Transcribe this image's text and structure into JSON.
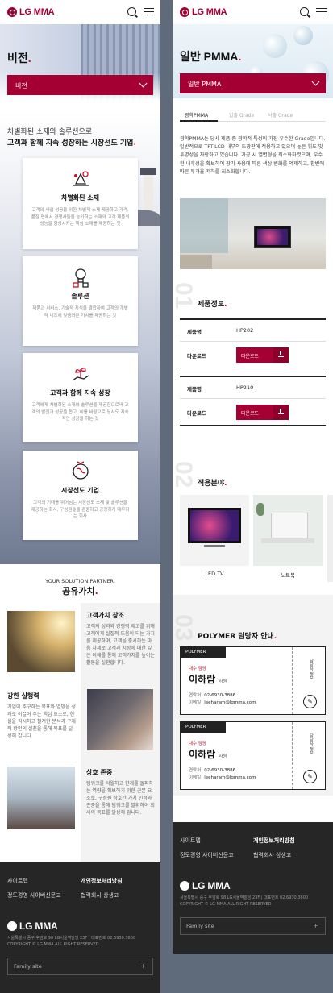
{
  "left": {
    "logo": "LG MMA",
    "page_title": "비전",
    "select_label": "비전",
    "intro_line1": "차별화된 소재와 솔루션으로",
    "intro_line2": "고객과 함께 지속 성장하는 시장선도 기업",
    "cards": [
      {
        "title": "차별화된 소재",
        "desc": "고객의 사업 성공을 위한 차별적 소재 제공하고 가격, 품질 면에서 경쟁사들을 능가하는 소재와 고객 제품의 성능을 향상시키는 핵심 소재를 제공하는 것"
      },
      {
        "title": "솔루션",
        "desc": "제품과 서비스, 기술적 지식을 결합하여 고객의 개별적 니즈에 맞춤화된 가치를 제공하는 것"
      },
      {
        "title": "고객과 함께 지속 성장",
        "desc": "고객에게 차별화된 소재와 솔루션을 제공함으로써 고객의 발전과 성공을 돕고, 이를 바탕으로 당사도 지속적인 성장을 하는 것"
      },
      {
        "title": "시장선도 기업",
        "desc": "고객의 기대를 뛰어넘는 시장선도 소재 및 솔루션을 제공하는 회사, 구성원들을 존중하고 공정하게 대우하는 회사"
      }
    ],
    "values_kicker": "YOUR SOLUTION PARTNER,",
    "values_title": "공유가치",
    "values": [
      {
        "title": "고객가치 창조",
        "desc": "고객의 성과와 경쟁력 제고를 위해 고객에게 실질적 도움이 되는 가치를 제공하며, 고객을 중시하는 마음 자세로 고객과 시장에 대한 깊은 이해를 통해 고객가치를 높이는 활동을 실천합니다."
      },
      {
        "title": "강한 실행력",
        "desc": "기업이 추구하는 목표와 열망을 성과로 이끌어 주는 핵심 요소로, 현실을 직시하고 철저한 분석과 구체적 방안의 실천을 통해 목표를 달성해 갑니다."
      },
      {
        "title": "상호 존중",
        "desc": "팀워크를 탁월하고 한계를 돌파하는 역량을 확보하기 위한 근본 요소로, 구성원 상호간 가치 인정과 존중을 통해 팀워크를 발휘하여 회사의 목표를 달성해 갑니다."
      }
    ],
    "footer": {
      "links": [
        "사이트맵",
        "개인정보처리방침",
        "정도경영 사이버신문고",
        "협력회사 상생고"
      ],
      "logo": "LG MMA",
      "address": "서울특별시 중구 후암로 98 LG서울역빌딩 23F | 대표번호 02.6930.3800",
      "copyright": "COPYRIGHT © LG MMA ALL RIGHT RESERVED",
      "family": "Family site"
    }
  },
  "right": {
    "logo": "LG MMA",
    "page_title": "일반 PMMA",
    "select_label": "일반 PMMA",
    "tabs": [
      "광학PMMA",
      "압출 Grade",
      "사출 Grade"
    ],
    "description": "광학PMMA는 당사 제품 중 광학적 특성이 가장 우수한 Grade입니다. 일반적으로 TFT-LCD 내부의 도광판에 적용하고 있으며 높은 휘도 및 투명성을 자랑하고 있습니다. 가공 시 열변형을 최소화하였으며, 우수한 내후성을 확보하여 장기 사용에 따른 색상 변화를 억제하고, 황변에 따른 투과율 저하를 최소화합니다.",
    "num1": "01",
    "product_info": "제품정보",
    "products": [
      {
        "name_key": "제품명",
        "name": "HP202",
        "dl_key": "다운로드",
        "dl_btn": "다운로드"
      },
      {
        "name_key": "제품명",
        "name": "HP210",
        "dl_key": "다운로드",
        "dl_btn": "다운로드"
      }
    ],
    "num2": "02",
    "applications_title": "적용분야",
    "applications": [
      "LED TV",
      "노트북"
    ],
    "num3": "03",
    "managers_title": "POLYMER 담당자 안내",
    "managers": [
      {
        "tag": "POLYMER",
        "dept": "내수 담당",
        "name": "이하람",
        "rank": "사원",
        "tel_label": "연락처",
        "tel": "02-6930-3886",
        "mail_label": "이메일",
        "mail": "leeharam@lgmma.com",
        "vertical": "담당자 정보"
      },
      {
        "tag": "POLYMER",
        "dept": "내수 담당",
        "name": "이하람",
        "rank": "사원",
        "tel_label": "연락처",
        "tel": "02-6930-3886",
        "mail_label": "이메일",
        "mail": "leeharam@lgmma.com",
        "vertical": "담당자 정보"
      }
    ],
    "footer": {
      "links": [
        "사이트맵",
        "개인정보처리방침",
        "정도경영 사이버신문고",
        "협력회사 상생고"
      ],
      "logo": "LG MMA",
      "address": "서울특별시 중구 후암로 98 LG서울역빌딩 23F | 대표번호 02.6930.3800",
      "copyright": "COPYRIGHT © LG MMA ALL RIGHT RESERVED",
      "family": "Family site"
    }
  },
  "colors": {
    "brand": "#a50034",
    "accent": "#c8102e",
    "footer": "#262626"
  }
}
